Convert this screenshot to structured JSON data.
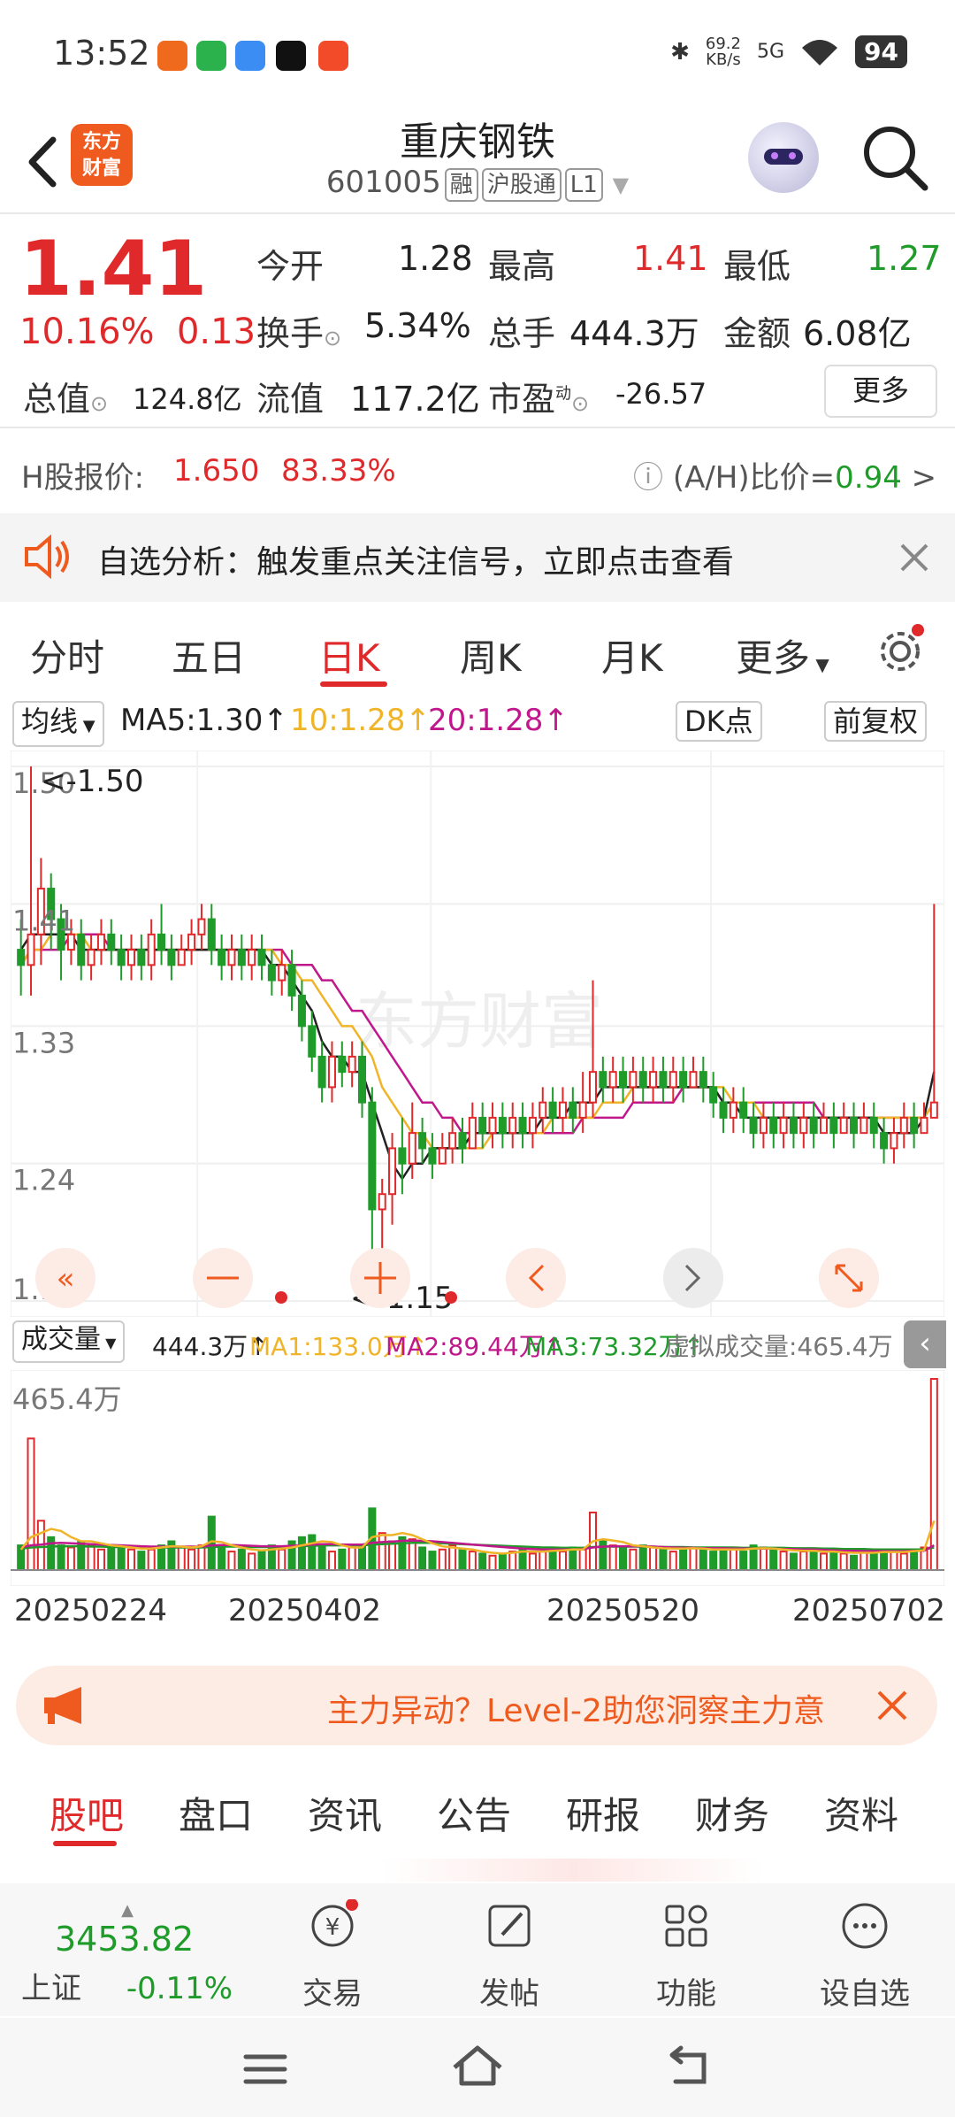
{
  "status_bar": {
    "time": "13:52",
    "net_speed_top": "69.2",
    "net_speed_unit": "KB/s",
    "network": "5G",
    "battery": "94"
  },
  "header": {
    "logo_line1": "东方",
    "logo_line2": "财富",
    "title": "重庆钢铁",
    "code": "601005",
    "tag_margin": "融",
    "tag_connect": "沪股通",
    "tag_level": "L1"
  },
  "quote": {
    "price": "1.41",
    "change_pct": "10.16%",
    "change_amt": "0.13",
    "open_label": "今开",
    "open": "1.28",
    "high_label": "最高",
    "high": "1.41",
    "low_label": "最低",
    "low": "1.27",
    "turnover_label": "换手",
    "turnover": "5.34%",
    "volume_label": "总手",
    "volume": "444.3万",
    "amount_label": "金额",
    "amount": "6.08亿",
    "mktcap_label": "总值",
    "mktcap": "124.8亿",
    "float_label": "流值",
    "float": "117.2亿",
    "pe_label": "市盈",
    "pe_sup": "动",
    "pe": "-26.57",
    "more_label": "更多"
  },
  "hshare": {
    "label": "H股报价:",
    "price": "1.650",
    "premium": "83.33%",
    "ratio_label": "(A/H)比价=",
    "ratio": "0.94",
    "arrow": ">"
  },
  "notice": {
    "text": "自选分析：触发重点关注信号，立即点击查看"
  },
  "periods": [
    "分时",
    "五日",
    "日K",
    "周K",
    "月K",
    "更多"
  ],
  "active_period": 2,
  "ma_legend": {
    "selector": "均线",
    "ma5": "MA5:1.30↑",
    "ma10": "10:1.28↑",
    "ma20": "20:1.28↑",
    "dk_label": "DK点",
    "adjust_label": "前复权"
  },
  "colors": {
    "up": "#e0292b",
    "down": "#1f9b2a",
    "ma5": "#222222",
    "ma10": "#f0b429",
    "ma20": "#c0188c",
    "brand": "#ef5a1e"
  },
  "chart_data": {
    "type": "candlestick",
    "ylim": [
      1.15,
      1.5
    ],
    "y_ticks": [
      "1.50",
      "1.41",
      "1.33",
      "1.24",
      "1.15"
    ],
    "max_label": "<-1.50",
    "min_label": "<-1.15",
    "watermark": "东方财富",
    "x_labels": [
      "20250224",
      "20250402",
      "20250520",
      "20250702"
    ],
    "volume_max_label": "465.4万",
    "candles": [
      [
        1.38,
        1.37,
        1.4,
        1.35
      ],
      [
        1.37,
        1.39,
        1.5,
        1.35
      ],
      [
        1.39,
        1.42,
        1.44,
        1.37
      ],
      [
        1.42,
        1.4,
        1.43,
        1.38
      ],
      [
        1.4,
        1.38,
        1.41,
        1.36
      ],
      [
        1.38,
        1.39,
        1.4,
        1.37
      ],
      [
        1.39,
        1.37,
        1.4,
        1.36
      ],
      [
        1.37,
        1.38,
        1.39,
        1.36
      ],
      [
        1.38,
        1.39,
        1.4,
        1.37
      ],
      [
        1.39,
        1.38,
        1.4,
        1.37
      ],
      [
        1.38,
        1.37,
        1.39,
        1.36
      ],
      [
        1.37,
        1.38,
        1.39,
        1.36
      ],
      [
        1.38,
        1.37,
        1.39,
        1.36
      ],
      [
        1.37,
        1.39,
        1.4,
        1.36
      ],
      [
        1.39,
        1.38,
        1.41,
        1.37
      ],
      [
        1.38,
        1.37,
        1.39,
        1.36
      ],
      [
        1.37,
        1.38,
        1.39,
        1.37
      ],
      [
        1.38,
        1.39,
        1.4,
        1.37
      ],
      [
        1.39,
        1.4,
        1.41,
        1.38
      ],
      [
        1.4,
        1.38,
        1.41,
        1.37
      ],
      [
        1.38,
        1.37,
        1.39,
        1.36
      ],
      [
        1.37,
        1.38,
        1.39,
        1.36
      ],
      [
        1.38,
        1.37,
        1.39,
        1.36
      ],
      [
        1.37,
        1.38,
        1.39,
        1.36
      ],
      [
        1.38,
        1.37,
        1.39,
        1.36
      ],
      [
        1.37,
        1.36,
        1.38,
        1.35
      ],
      [
        1.36,
        1.37,
        1.38,
        1.35
      ],
      [
        1.37,
        1.35,
        1.38,
        1.34
      ],
      [
        1.35,
        1.33,
        1.36,
        1.32
      ],
      [
        1.33,
        1.31,
        1.34,
        1.3
      ],
      [
        1.31,
        1.29,
        1.32,
        1.28
      ],
      [
        1.29,
        1.31,
        1.32,
        1.28
      ],
      [
        1.31,
        1.3,
        1.32,
        1.29
      ],
      [
        1.3,
        1.31,
        1.32,
        1.29
      ],
      [
        1.31,
        1.28,
        1.32,
        1.27
      ],
      [
        1.28,
        1.21,
        1.29,
        1.15
      ],
      [
        1.21,
        1.22,
        1.23,
        1.18
      ],
      [
        1.22,
        1.25,
        1.26,
        1.2
      ],
      [
        1.25,
        1.24,
        1.27,
        1.22
      ],
      [
        1.24,
        1.26,
        1.28,
        1.23
      ],
      [
        1.26,
        1.25,
        1.27,
        1.24
      ],
      [
        1.25,
        1.24,
        1.26,
        1.23
      ],
      [
        1.24,
        1.25,
        1.26,
        1.24
      ],
      [
        1.25,
        1.26,
        1.27,
        1.24
      ],
      [
        1.26,
        1.25,
        1.27,
        1.24
      ],
      [
        1.25,
        1.27,
        1.28,
        1.25
      ],
      [
        1.27,
        1.26,
        1.28,
        1.25
      ],
      [
        1.26,
        1.27,
        1.28,
        1.25
      ],
      [
        1.27,
        1.26,
        1.28,
        1.25
      ],
      [
        1.26,
        1.27,
        1.28,
        1.25
      ],
      [
        1.27,
        1.26,
        1.28,
        1.25
      ],
      [
        1.26,
        1.27,
        1.28,
        1.25
      ],
      [
        1.27,
        1.28,
        1.29,
        1.26
      ],
      [
        1.28,
        1.27,
        1.29,
        1.26
      ],
      [
        1.27,
        1.28,
        1.29,
        1.26
      ],
      [
        1.28,
        1.27,
        1.29,
        1.26
      ],
      [
        1.27,
        1.28,
        1.3,
        1.26
      ],
      [
        1.28,
        1.3,
        1.36,
        1.27
      ],
      [
        1.3,
        1.29,
        1.31,
        1.28
      ],
      [
        1.29,
        1.3,
        1.31,
        1.28
      ],
      [
        1.3,
        1.29,
        1.31,
        1.28
      ],
      [
        1.29,
        1.3,
        1.31,
        1.28
      ],
      [
        1.3,
        1.29,
        1.31,
        1.28
      ],
      [
        1.29,
        1.3,
        1.31,
        1.28
      ],
      [
        1.3,
        1.29,
        1.31,
        1.28
      ],
      [
        1.29,
        1.3,
        1.31,
        1.28
      ],
      [
        1.3,
        1.29,
        1.31,
        1.28
      ],
      [
        1.29,
        1.3,
        1.31,
        1.29
      ],
      [
        1.3,
        1.29,
        1.31,
        1.28
      ],
      [
        1.29,
        1.28,
        1.3,
        1.27
      ],
      [
        1.28,
        1.27,
        1.29,
        1.26
      ],
      [
        1.27,
        1.28,
        1.29,
        1.26
      ],
      [
        1.28,
        1.27,
        1.29,
        1.26
      ],
      [
        1.27,
        1.26,
        1.28,
        1.25
      ],
      [
        1.26,
        1.27,
        1.28,
        1.25
      ],
      [
        1.27,
        1.26,
        1.28,
        1.25
      ],
      [
        1.26,
        1.27,
        1.28,
        1.25
      ],
      [
        1.27,
        1.26,
        1.28,
        1.25
      ],
      [
        1.26,
        1.27,
        1.28,
        1.25
      ],
      [
        1.27,
        1.26,
        1.28,
        1.25
      ],
      [
        1.26,
        1.27,
        1.28,
        1.26
      ],
      [
        1.27,
        1.26,
        1.28,
        1.25
      ],
      [
        1.26,
        1.27,
        1.28,
        1.26
      ],
      [
        1.27,
        1.26,
        1.28,
        1.25
      ],
      [
        1.26,
        1.27,
        1.28,
        1.26
      ],
      [
        1.27,
        1.26,
        1.28,
        1.25
      ],
      [
        1.26,
        1.25,
        1.27,
        1.24
      ],
      [
        1.25,
        1.26,
        1.27,
        1.24
      ],
      [
        1.26,
        1.27,
        1.28,
        1.25
      ],
      [
        1.27,
        1.26,
        1.28,
        1.25
      ],
      [
        1.26,
        1.27,
        1.28,
        1.26
      ],
      [
        1.27,
        1.28,
        1.41,
        1.27
      ]
    ],
    "ma5": [
      1.38,
      1.39,
      1.39,
      1.39,
      1.39,
      1.39,
      1.38,
      1.38,
      1.38,
      1.38,
      1.38,
      1.38,
      1.38,
      1.38,
      1.38,
      1.38,
      1.38,
      1.38,
      1.38,
      1.38,
      1.38,
      1.38,
      1.38,
      1.38,
      1.38,
      1.37,
      1.37,
      1.36,
      1.35,
      1.34,
      1.32,
      1.31,
      1.31,
      1.3,
      1.3,
      1.28,
      1.26,
      1.24,
      1.23,
      1.24,
      1.24,
      1.25,
      1.25,
      1.25,
      1.25,
      1.26,
      1.26,
      1.26,
      1.26,
      1.26,
      1.26,
      1.26,
      1.27,
      1.27,
      1.27,
      1.28,
      1.28,
      1.28,
      1.29,
      1.29,
      1.29,
      1.29,
      1.29,
      1.29,
      1.29,
      1.29,
      1.29,
      1.29,
      1.29,
      1.29,
      1.28,
      1.28,
      1.27,
      1.27,
      1.27,
      1.27,
      1.27,
      1.27,
      1.27,
      1.27,
      1.27,
      1.27,
      1.27,
      1.27,
      1.27,
      1.27,
      1.26,
      1.26,
      1.26,
      1.26,
      1.27,
      1.3
    ],
    "ma10": [
      1.37,
      1.38,
      1.38,
      1.39,
      1.39,
      1.39,
      1.39,
      1.38,
      1.38,
      1.38,
      1.38,
      1.38,
      1.38,
      1.38,
      1.38,
      1.38,
      1.38,
      1.38,
      1.38,
      1.38,
      1.38,
      1.38,
      1.38,
      1.38,
      1.38,
      1.38,
      1.37,
      1.37,
      1.36,
      1.36,
      1.35,
      1.34,
      1.33,
      1.33,
      1.32,
      1.31,
      1.29,
      1.28,
      1.27,
      1.26,
      1.26,
      1.25,
      1.25,
      1.25,
      1.25,
      1.25,
      1.25,
      1.26,
      1.26,
      1.26,
      1.26,
      1.26,
      1.26,
      1.27,
      1.27,
      1.27,
      1.27,
      1.27,
      1.28,
      1.28,
      1.28,
      1.29,
      1.29,
      1.29,
      1.29,
      1.29,
      1.29,
      1.29,
      1.29,
      1.29,
      1.29,
      1.28,
      1.28,
      1.28,
      1.27,
      1.27,
      1.27,
      1.27,
      1.27,
      1.27,
      1.27,
      1.27,
      1.27,
      1.27,
      1.27,
      1.27,
      1.27,
      1.27,
      1.27,
      1.27,
      1.27,
      1.28
    ],
    "ma20": [
      1.37,
      1.38,
      1.38,
      1.38,
      1.38,
      1.39,
      1.39,
      1.39,
      1.39,
      1.38,
      1.38,
      1.38,
      1.38,
      1.38,
      1.38,
      1.38,
      1.38,
      1.38,
      1.38,
      1.38,
      1.38,
      1.38,
      1.38,
      1.38,
      1.38,
      1.38,
      1.38,
      1.37,
      1.37,
      1.37,
      1.36,
      1.36,
      1.35,
      1.34,
      1.34,
      1.33,
      1.32,
      1.31,
      1.3,
      1.29,
      1.28,
      1.28,
      1.27,
      1.27,
      1.26,
      1.26,
      1.26,
      1.26,
      1.26,
      1.26,
      1.26,
      1.26,
      1.26,
      1.26,
      1.26,
      1.26,
      1.27,
      1.27,
      1.27,
      1.27,
      1.27,
      1.28,
      1.28,
      1.28,
      1.28,
      1.28,
      1.29,
      1.29,
      1.29,
      1.29,
      1.28,
      1.28,
      1.28,
      1.28,
      1.28,
      1.28,
      1.28,
      1.28,
      1.28,
      1.28,
      1.27,
      1.27,
      1.27,
      1.27,
      1.27,
      1.27,
      1.27,
      1.27,
      1.27,
      1.27,
      1.27,
      1.28
    ],
    "volume": [
      60,
      320,
      120,
      80,
      60,
      55,
      70,
      60,
      50,
      60,
      55,
      50,
      45,
      50,
      60,
      70,
      55,
      50,
      60,
      130,
      55,
      45,
      50,
      40,
      45,
      60,
      50,
      70,
      80,
      85,
      60,
      45,
      50,
      55,
      60,
      150,
      90,
      70,
      80,
      75,
      55,
      45,
      50,
      60,
      50,
      45,
      40,
      35,
      40,
      45,
      50,
      40,
      45,
      50,
      45,
      55,
      50,
      140,
      70,
      60,
      55,
      50,
      60,
      55,
      50,
      45,
      50,
      55,
      50,
      45,
      55,
      50,
      45,
      60,
      55,
      50,
      45,
      40,
      45,
      50,
      40,
      45,
      40,
      35,
      45,
      40,
      50,
      45,
      40,
      50,
      55,
      465
    ],
    "vol_ma1": [
      50,
      80,
      90,
      100,
      95,
      80,
      70,
      70,
      65,
      60,
      58,
      55,
      52,
      52,
      55,
      58,
      57,
      55,
      58,
      70,
      68,
      60,
      55,
      50,
      48,
      50,
      52,
      55,
      60,
      65,
      70,
      68,
      60,
      55,
      55,
      80,
      85,
      85,
      90,
      85,
      75,
      65,
      58,
      55,
      52,
      50,
      45,
      42,
      40,
      42,
      45,
      45,
      45,
      47,
      48,
      50,
      50,
      70,
      75,
      72,
      68,
      60,
      58,
      55,
      53,
      52,
      52,
      53,
      52,
      50,
      50,
      50,
      50,
      52,
      53,
      52,
      50,
      48,
      47,
      47,
      45,
      45,
      43,
      42,
      42,
      42,
      44,
      44,
      44,
      46,
      48,
      120
    ],
    "vol_ma2": [
      55,
      60,
      62,
      65,
      66,
      65,
      64,
      63,
      62,
      61,
      60,
      59,
      58,
      57,
      57,
      57,
      57,
      57,
      57,
      60,
      61,
      61,
      60,
      59,
      58,
      58,
      58,
      59,
      60,
      62,
      63,
      63,
      62,
      62,
      62,
      66,
      68,
      69,
      71,
      72,
      71,
      70,
      68,
      66,
      64,
      62,
      60,
      58,
      56,
      54,
      52,
      51,
      50,
      50,
      50,
      50,
      51,
      55,
      57,
      58,
      58,
      58,
      58,
      57,
      56,
      55,
      54,
      54,
      53,
      53,
      53,
      52,
      52,
      52,
      52,
      52,
      51,
      51,
      50,
      50,
      49,
      48,
      47,
      47,
      46,
      46,
      46,
      46,
      46,
      47,
      47,
      60
    ],
    "vol_ma3": [
      52,
      55,
      56,
      57,
      58,
      58,
      58,
      57,
      57,
      56,
      56,
      56,
      55,
      55,
      55,
      55,
      55,
      55,
      55,
      56,
      57,
      57,
      57,
      56,
      56,
      56,
      56,
      57,
      58,
      59,
      60,
      60,
      60,
      60,
      60,
      62,
      63,
      64,
      65,
      66,
      66,
      66,
      65,
      64,
      63,
      62,
      61,
      60,
      59,
      58,
      57,
      56,
      55,
      55,
      54,
      54,
      54,
      56,
      57,
      57,
      57,
      57,
      57,
      57,
      56,
      56,
      56,
      55,
      55,
      55,
      55,
      55,
      54,
      54,
      54,
      54,
      54,
      53,
      53,
      53,
      52,
      52,
      51,
      51,
      51,
      50,
      50,
      50,
      50,
      50,
      50,
      55
    ]
  },
  "vol_legend": {
    "selector": "成交量",
    "volume": "444.3万↑",
    "ma1": "MA1:133.0万↑",
    "ma2": "MA2:89.44万↑",
    "ma3": "MA3:73.32万↑",
    "virtual": "虚拟成交量:465.4万"
  },
  "promo": {
    "text": "主力异动？Level-2助您洞察主力意"
  },
  "tabs2": [
    "股吧",
    "盘口",
    "资讯",
    "公告",
    "研报",
    "财务",
    "资料"
  ],
  "bottom_nav": {
    "index_value": "3453.82",
    "index_name": "上证",
    "index_change": "-0.11%",
    "trade": "交易",
    "post": "发帖",
    "function": "功能",
    "add_watch": "设自选"
  }
}
